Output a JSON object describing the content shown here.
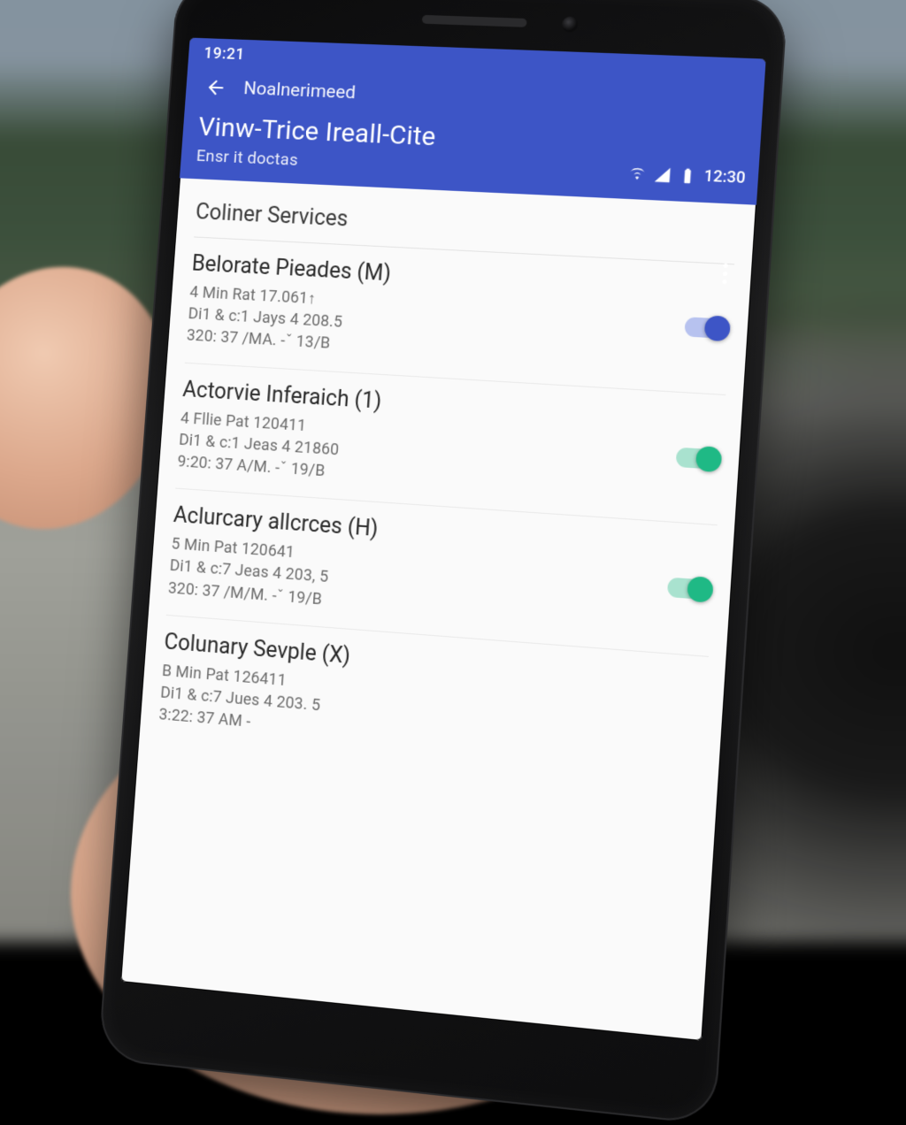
{
  "status": {
    "inapp_time": "19:21",
    "system_time": "12:30"
  },
  "appbar": {
    "crumb": "Noalnerimeed",
    "title": "Vinw-Trice Ireall-Cite",
    "subtitle": "Ensr it doctas"
  },
  "section": {
    "header": "Coliner Services"
  },
  "items": [
    {
      "title": "Belorate Pieades (M)",
      "line1": "4 Min Rat 17.061↑",
      "line2": "Di1 & c:1 Jays 4 208.5",
      "line3": "320: 37 /MA. -ˇ 13/B",
      "toggle": "on-blue"
    },
    {
      "title": "Actorvie Inferaich (1)",
      "line1": "4 Fllie Pat 120411",
      "line2": "Di1 & c:1 Jeas 4 21860",
      "line3": "9:20: 37 A/M. -ˇ 19/B",
      "toggle": "on-green"
    },
    {
      "title": "Aclurcary allcrces (H)",
      "line1": "5 Min Pat 120641",
      "line2": "Di1 & c:7 Jeas 4 203, 5",
      "line3": "320: 37 /M/M. -ˇ 19/B",
      "toggle": "on-green"
    },
    {
      "title": "Colunary Sevple (X)",
      "line1": "B Min Pat 126411",
      "line2": "Di1 & c:7 Jues 4 203. 5",
      "line3": "3:22: 37 AM -",
      "toggle": "off"
    }
  ]
}
